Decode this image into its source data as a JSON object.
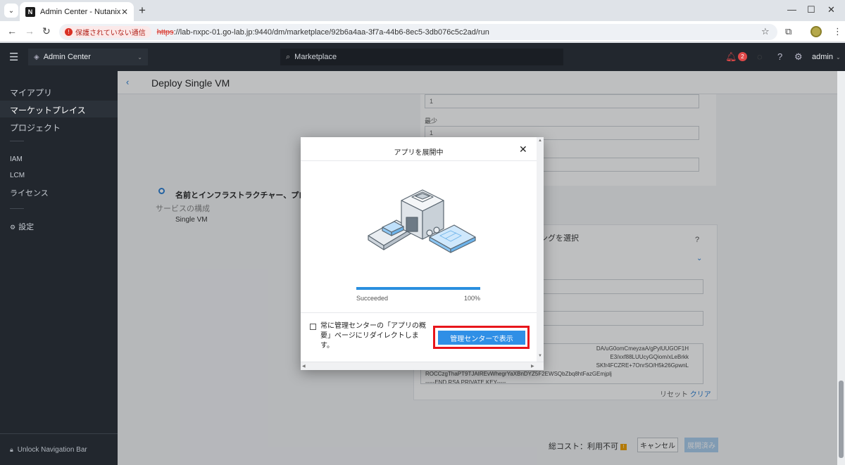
{
  "browser": {
    "tab_title": "Admin Center - Nutanix",
    "favicon_text": "N",
    "security_warning": "保護されていない通信",
    "url_scheme": "https",
    "url_rest": "://lab-nxpc-01.go-lab.jp:9440/dm/marketplace/92b6a4aa-3f7a-44b6-8ec5-3db076c5c2ad/run"
  },
  "header": {
    "app_selector": "Admin Center",
    "search_placeholder": "Marketplace",
    "alert_count": "2",
    "user": "admin"
  },
  "sidebar": {
    "items": [
      {
        "label": "マイアプリ"
      },
      {
        "label": "マーケットプレイス"
      },
      {
        "label": "プロジェクト"
      },
      {
        "label": "IAM"
      },
      {
        "label": "LCM"
      },
      {
        "label": "ライセンス"
      },
      {
        "label": "設定"
      }
    ],
    "unlock_label": "Unlock Navigation Bar"
  },
  "page": {
    "title": "Deploy Single VM",
    "fields": [
      {
        "label": "",
        "value": "1"
      },
      {
        "label": "最少",
        "value": "1"
      }
    ],
    "steps": {
      "step1": "名前とインフラストラクチャー、プロフ",
      "step2": "サービスの構成",
      "step2_sub": "Single VM"
    },
    "config_title": "ングを選択",
    "help_mark": "?",
    "key_lines": [
      "DA/uG0omCmeyzaA/gPylUUGOF1H",
      "E3/xxf88LUUcyGQiom/xLeBrkk",
      "SKfr4FCZRE+7OnrSO/H5k26GpwnL",
      "ROCCzgThaPT9TJAIREvWhegrYaXBnDYZ5F2EWSQbZbq8htFazGEmjplj",
      "-----END RSA PRIVATE KEY-----"
    ],
    "reset_label": "リセット",
    "clear_label": "クリア",
    "total_cost_label": "総コスト：利用不可",
    "cancel_label": "キャンセル",
    "deploy_label": "展開済み"
  },
  "modal": {
    "title": "アプリを展開中",
    "status": "Succeeded",
    "progress_percent": "100%",
    "progress_value": 1.0,
    "checkbox_label": "常に管理センターの「アプリの概要」ページにリダイレクトします。",
    "view_button": "管理センターで表示"
  },
  "colors": {
    "accent": "#2f8fe6",
    "highlight_box": "#e8151b",
    "nav_bg": "#22272e"
  }
}
